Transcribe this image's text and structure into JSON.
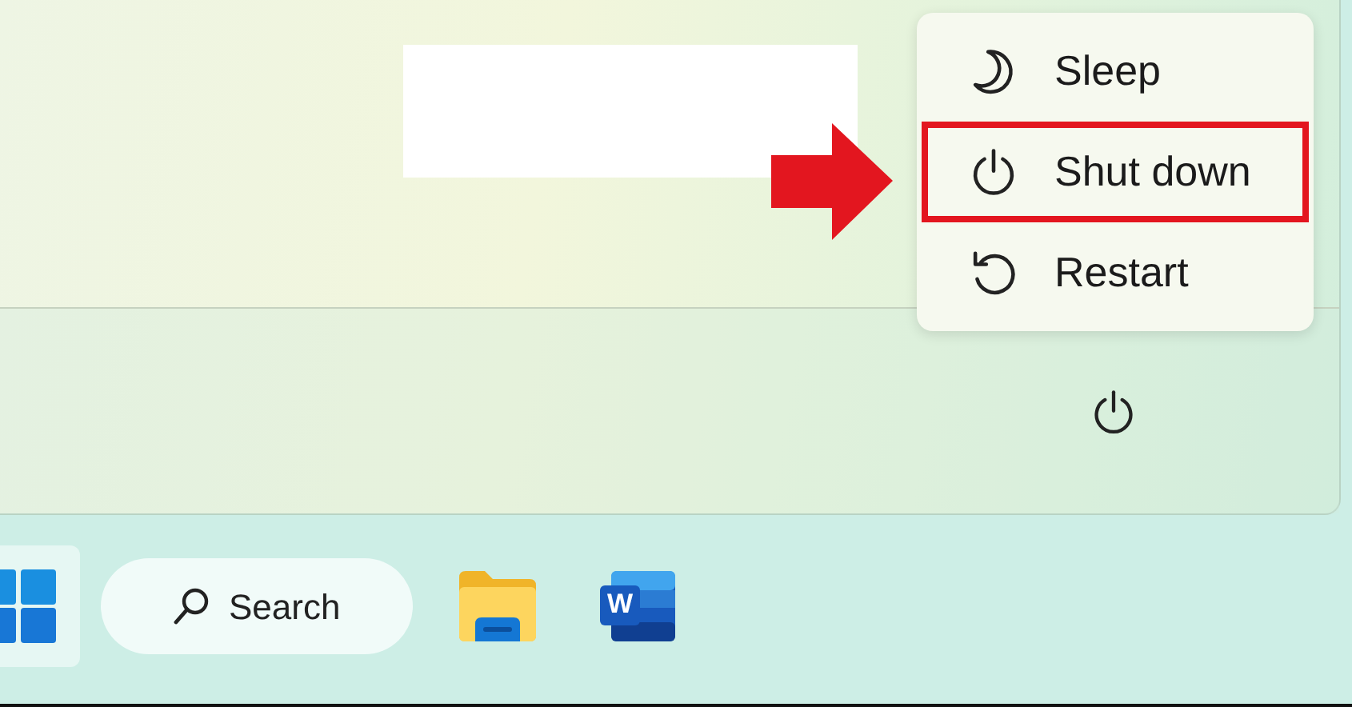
{
  "start_menu": {
    "power_menu": {
      "expanded": true,
      "items": [
        {
          "kind": "sleep",
          "label": "Sleep",
          "highlighted": false
        },
        {
          "kind": "shutdown",
          "label": "Shut down",
          "highlighted": true
        },
        {
          "kind": "restart",
          "label": "Restart",
          "highlighted": false
        }
      ]
    }
  },
  "taskbar": {
    "search": {
      "placeholder": "Search"
    },
    "apps": [
      {
        "kind": "folder"
      },
      {
        "kind": "word",
        "letter": "W"
      }
    ]
  }
}
